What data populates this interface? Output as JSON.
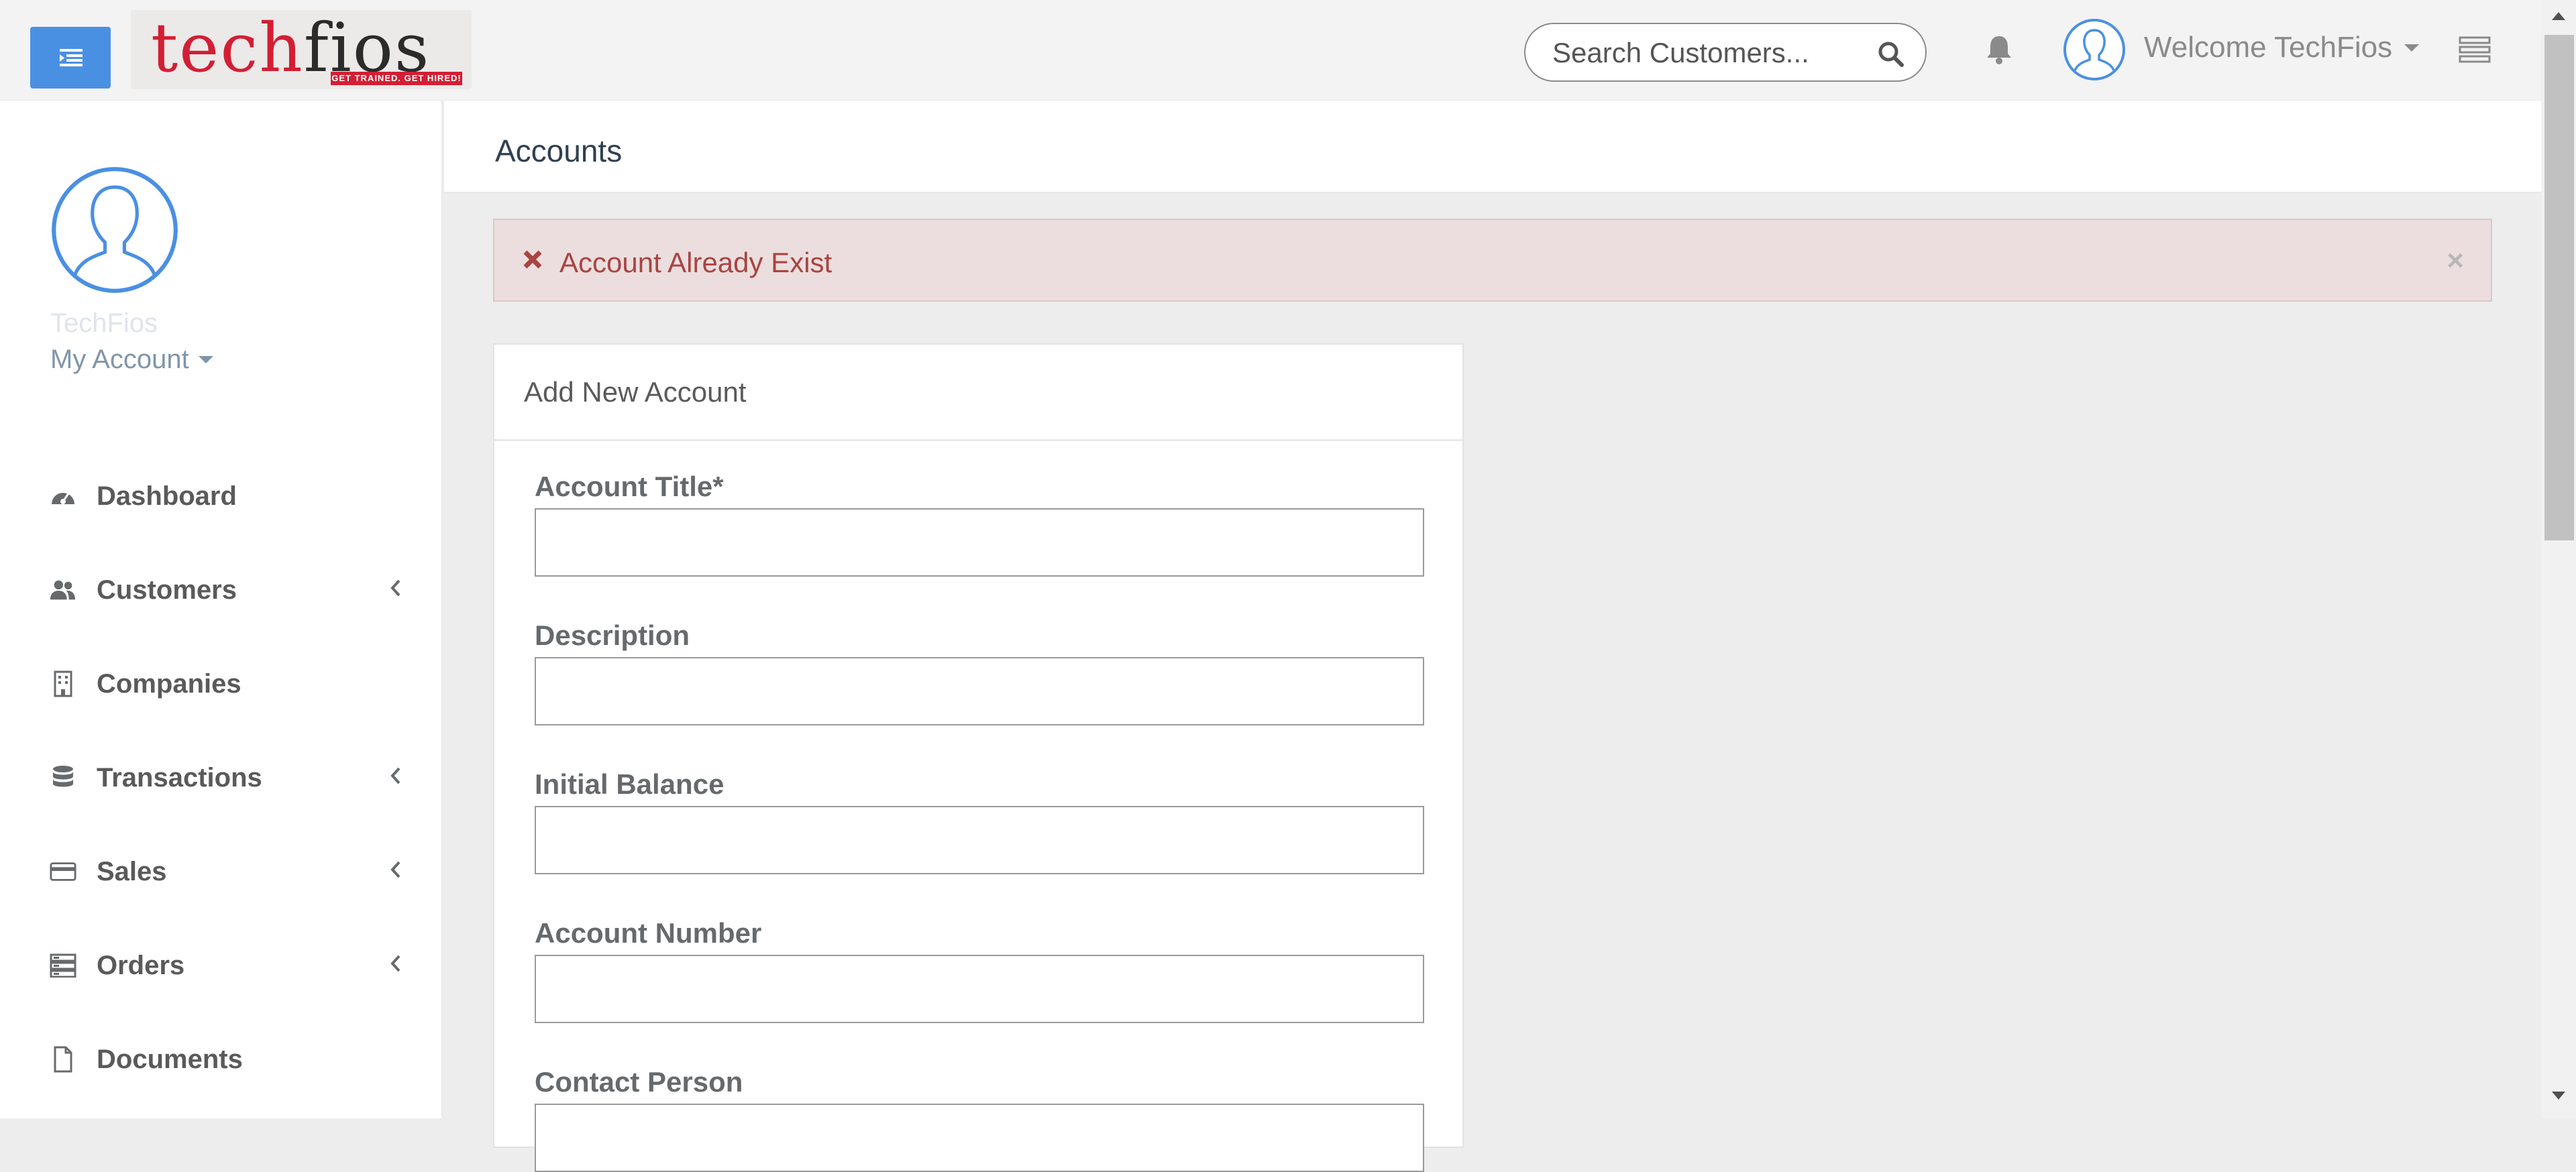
{
  "header": {
    "logo": {
      "tech": "tech",
      "fios": "fios",
      "tagline": "GET TRAINED. GET HIRED!"
    },
    "search_placeholder": "Search Customers...",
    "welcome": "Welcome TechFios"
  },
  "sidebar": {
    "user_name": "TechFios",
    "my_account": "My Account",
    "items": [
      {
        "label": "Dashboard",
        "icon": "dashboard-icon",
        "has_submenu": false
      },
      {
        "label": "Customers",
        "icon": "users-icon",
        "has_submenu": true
      },
      {
        "label": "Companies",
        "icon": "building-icon",
        "has_submenu": false
      },
      {
        "label": "Transactions",
        "icon": "database-icon",
        "has_submenu": true
      },
      {
        "label": "Sales",
        "icon": "credit-card-icon",
        "has_submenu": true
      },
      {
        "label": "Orders",
        "icon": "server-icon",
        "has_submenu": true
      },
      {
        "label": "Documents",
        "icon": "file-icon",
        "has_submenu": false
      }
    ]
  },
  "main": {
    "page_title": "Accounts",
    "alert": {
      "message": "Account Already Exist",
      "close": "×"
    },
    "panel": {
      "title": "Add New Account",
      "fields": [
        {
          "label": "Account Title*",
          "value": ""
        },
        {
          "label": "Description",
          "value": ""
        },
        {
          "label": "Initial Balance",
          "value": ""
        },
        {
          "label": "Account Number",
          "value": ""
        },
        {
          "label": "Contact Person",
          "value": ""
        }
      ]
    }
  },
  "colors": {
    "accent": "#4a90e2",
    "alert_bg": "#ecdede",
    "alert_text": "#a94442",
    "brand_red": "#d21f34"
  }
}
